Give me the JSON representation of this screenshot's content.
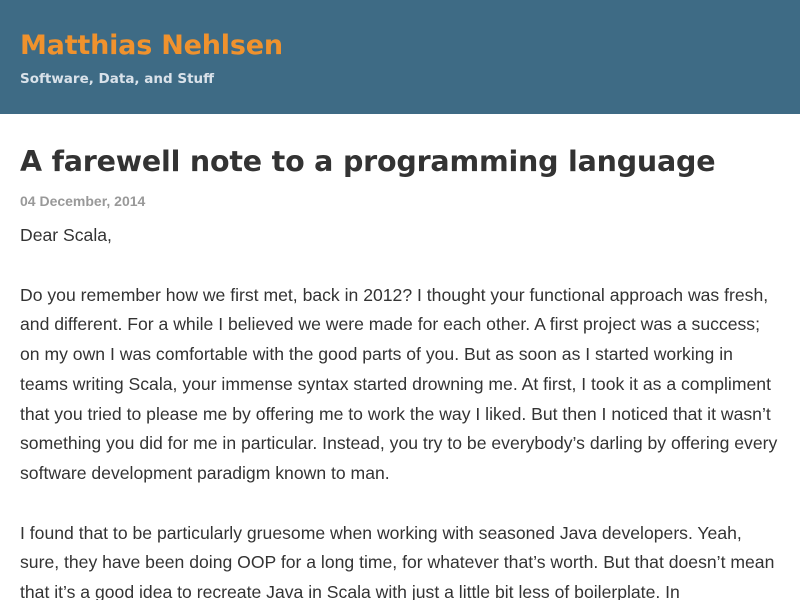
{
  "header": {
    "site_title": "Matthias Nehlsen",
    "tagline": "Software, Data, and Stuff",
    "colors": {
      "background": "#3e6b85",
      "title": "#f0922d",
      "tagline": "#d9e2ea"
    }
  },
  "post": {
    "title": "A farewell note to a programming language",
    "date": "04 December, 2014",
    "paragraphs": [
      "Dear Scala,",
      "Do you remember how we first met, back in 2012? I thought your functional approach was fresh, and different. For a while I believed we were made for each other. A first project was a success; on my own I was comfortable with the good parts of you. But as soon as I started working in teams writing Scala, your immense syntax started drowning me. At first, I took it as a compliment that you tried to please me by offering me to work the way I liked. But then I noticed that it wasn’t something you did for me in particular. Instead, you try to be everybody’s darling by offering every software development paradigm known to man.",
      "I found that to be particularly gruesome when working with seasoned Java developers. Yeah, sure, they have been doing OOP for a long time, for whatever that’s worth. But that doesn’t mean that it’s a good idea to recreate Java in Scala with just a little bit less of boilerplate. In"
    ]
  }
}
